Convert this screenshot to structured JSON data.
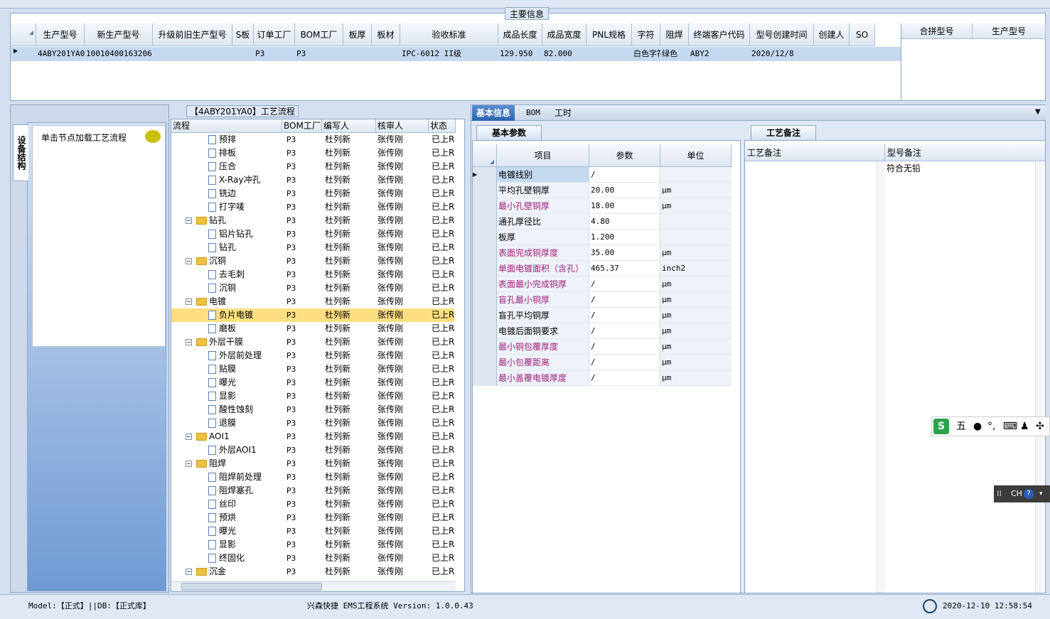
{
  "main": {
    "title": "主要信息",
    "columns": [
      "生产型号",
      "新生产型号",
      "升级前旧生产型号",
      "S板",
      "订单工厂",
      "BOM工厂",
      "板厚",
      "板材",
      "验收标准",
      "成品长度",
      "成品宽度",
      "PNL规格",
      "字符",
      "阻焊",
      "终端客户代码",
      "型号创建时间",
      "创建人",
      "SO"
    ],
    "row": {
      "model": "4ABY201YA0",
      "new_model": "10010400163206",
      "old_model": "",
      "s": "",
      "order_factory": "P3",
      "bom_factory": "P3",
      "thickness": "",
      "material": "",
      "standard": "IPC-6012 II级",
      "length": "129.950",
      "width": "82.000",
      "pnl": "",
      "char": "白色字符",
      "mask": "绿色",
      "customer": "ABY2",
      "created": "2020/12/8",
      "creator": "",
      "so": ""
    },
    "side_columns": [
      "合拼型号",
      "生产型号"
    ]
  },
  "left": {
    "vtab": "设备结构",
    "hint": "单击节点加载工艺流程"
  },
  "flow": {
    "title": "【4ABY201YA0】工艺流程",
    "columns": [
      "流程",
      "BOM工厂",
      "编写人",
      "核审人",
      "状态"
    ],
    "rows": [
      {
        "name": "预排",
        "type": "doc",
        "f": "P3",
        "w": "杜列新",
        "r": "张传刚",
        "s": "已上R"
      },
      {
        "name": "排板",
        "type": "doc",
        "f": "P3",
        "w": "杜列新",
        "r": "张传刚",
        "s": "已上R"
      },
      {
        "name": "压合",
        "type": "doc",
        "f": "P3",
        "w": "杜列新",
        "r": "张传刚",
        "s": "已上R"
      },
      {
        "name": "X-Ray冲孔",
        "type": "doc",
        "f": "P3",
        "w": "杜列新",
        "r": "张传刚",
        "s": "已上R"
      },
      {
        "name": "铣边",
        "type": "doc",
        "f": "P3",
        "w": "杜列新",
        "r": "张传刚",
        "s": "已上R"
      },
      {
        "name": "打字唛",
        "type": "doc",
        "f": "P3",
        "w": "杜列新",
        "r": "张传刚",
        "s": "已上R"
      },
      {
        "name": "钻孔",
        "type": "folder",
        "f": "P3",
        "w": "杜列新",
        "r": "张传刚",
        "s": "已上R"
      },
      {
        "name": "铝片钻孔",
        "type": "doc",
        "f": "P3",
        "w": "杜列新",
        "r": "张传刚",
        "s": "已上R"
      },
      {
        "name": "钻孔",
        "type": "doc",
        "f": "P3",
        "w": "杜列新",
        "r": "张传刚",
        "s": "已上R"
      },
      {
        "name": "沉铜",
        "type": "folder",
        "f": "P3",
        "w": "杜列新",
        "r": "张传刚",
        "s": "已上R"
      },
      {
        "name": "去毛刺",
        "type": "doc",
        "f": "P3",
        "w": "杜列新",
        "r": "张传刚",
        "s": "已上R"
      },
      {
        "name": "沉铜",
        "type": "doc",
        "f": "P3",
        "w": "杜列新",
        "r": "张传刚",
        "s": "已上R"
      },
      {
        "name": "电镀",
        "type": "folder",
        "f": "P3",
        "w": "杜列新",
        "r": "张传刚",
        "s": "已上R"
      },
      {
        "name": "负片电镀",
        "type": "doc",
        "f": "P3",
        "w": "杜列新",
        "r": "张传刚",
        "s": "已上R",
        "sel": true
      },
      {
        "name": "磨板",
        "type": "doc",
        "f": "P3",
        "w": "杜列新",
        "r": "张传刚",
        "s": "已上R"
      },
      {
        "name": "外层干膜",
        "type": "folder",
        "f": "P3",
        "w": "杜列新",
        "r": "张传刚",
        "s": "已上R"
      },
      {
        "name": "外层前处理",
        "type": "doc",
        "f": "P3",
        "w": "杜列新",
        "r": "张传刚",
        "s": "已上R"
      },
      {
        "name": "贴膜",
        "type": "doc",
        "f": "P3",
        "w": "杜列新",
        "r": "张传刚",
        "s": "已上R"
      },
      {
        "name": "曝光",
        "type": "doc",
        "f": "P3",
        "w": "杜列新",
        "r": "张传刚",
        "s": "已上R"
      },
      {
        "name": "显影",
        "type": "doc",
        "f": "P3",
        "w": "杜列新",
        "r": "张传刚",
        "s": "已上R"
      },
      {
        "name": "酸性蚀刻",
        "type": "doc",
        "f": "P3",
        "w": "杜列新",
        "r": "张传刚",
        "s": "已上R"
      },
      {
        "name": "退膜",
        "type": "doc",
        "f": "P3",
        "w": "杜列新",
        "r": "张传刚",
        "s": "已上R"
      },
      {
        "name": "AOI1",
        "type": "folder",
        "f": "P3",
        "w": "杜列新",
        "r": "张传刚",
        "s": "已上R"
      },
      {
        "name": "外层AOI1",
        "type": "doc",
        "f": "P3",
        "w": "杜列新",
        "r": "张传刚",
        "s": "已上R"
      },
      {
        "name": "阻焊",
        "type": "folder",
        "f": "P3",
        "w": "杜列新",
        "r": "张传刚",
        "s": "已上R"
      },
      {
        "name": "阻焊前处理",
        "type": "doc",
        "f": "P3",
        "w": "杜列新",
        "r": "张传刚",
        "s": "已上R"
      },
      {
        "name": "阻焊塞孔",
        "type": "doc",
        "f": "P3",
        "w": "杜列新",
        "r": "张传刚",
        "s": "已上R"
      },
      {
        "name": "丝印",
        "type": "doc",
        "f": "P3",
        "w": "杜列新",
        "r": "张传刚",
        "s": "已上R"
      },
      {
        "name": "预烘",
        "type": "doc",
        "f": "P3",
        "w": "杜列新",
        "r": "张传刚",
        "s": "已上R"
      },
      {
        "name": "曝光",
        "type": "doc",
        "f": "P3",
        "w": "杜列新",
        "r": "张传刚",
        "s": "已上R"
      },
      {
        "name": "显影",
        "type": "doc",
        "f": "P3",
        "w": "杜列新",
        "r": "张传刚",
        "s": "已上R"
      },
      {
        "name": "终固化",
        "type": "doc",
        "f": "P3",
        "w": "杜列新",
        "r": "张传刚",
        "s": "已上R"
      },
      {
        "name": "沉金",
        "type": "folder",
        "f": "P3",
        "w": "杜列新",
        "r": "张传刚",
        "s": "已上R"
      }
    ]
  },
  "tabs": [
    "基本信息",
    "BOM",
    "工时"
  ],
  "basic": {
    "tab": "基本参数",
    "columns": [
      "项目",
      "参数",
      "单位"
    ],
    "rows": [
      {
        "item": "电镀线别",
        "val": "/",
        "unit": "",
        "pink": false
      },
      {
        "item": "平均孔壁铜厚",
        "val": "20.00",
        "unit": "μm",
        "pink": false
      },
      {
        "item": "最小孔壁铜厚",
        "val": "18.00",
        "unit": "μm",
        "pink": true
      },
      {
        "item": "通孔厚径比",
        "val": "4.80",
        "unit": "",
        "pink": false
      },
      {
        "item": "板厚",
        "val": "1.200",
        "unit": "",
        "pink": false
      },
      {
        "item": "表面完成铜厚度",
        "val": "35.00",
        "unit": "μm",
        "pink": true
      },
      {
        "item": "单面电镀面积（含孔）",
        "val": "465.37",
        "unit": "inch2",
        "pink": true
      },
      {
        "item": "表面最小完成铜厚",
        "val": "/",
        "unit": "μm",
        "pink": true
      },
      {
        "item": "盲孔最小铜厚",
        "val": "/",
        "unit": "μm",
        "pink": true
      },
      {
        "item": "盲孔平均铜厚",
        "val": "/",
        "unit": "μm",
        "pink": false
      },
      {
        "item": "电镀后面铜要求",
        "val": "/",
        "unit": "μm",
        "pink": false
      },
      {
        "item": "最小铜包覆厚度",
        "val": "/",
        "unit": "μm",
        "pink": true
      },
      {
        "item": "最小包覆距离",
        "val": "/",
        "unit": "μm",
        "pink": true
      },
      {
        "item": "最小盖覆电镀厚度",
        "val": "/",
        "unit": "μm",
        "pink": true
      }
    ]
  },
  "remark": {
    "tab": "工艺备注",
    "columns": [
      "工艺备注",
      "型号备注"
    ],
    "model_remark": "符合无铅"
  },
  "status": {
    "left": "Model:【正式】||DB:【正式库】",
    "center": "兴森快捷 EMS工程系统 Version: 1.0.0.43",
    "time": "2020-12-10 12:58:54"
  },
  "ime": {
    "label": "五",
    "lang": "CH"
  }
}
